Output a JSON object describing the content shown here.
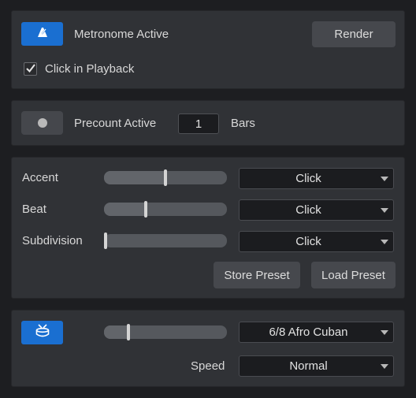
{
  "metronome": {
    "active_label": "Metronome Active",
    "render_label": "Render",
    "click_in_playback_label": "Click in Playback",
    "click_in_playback_checked": true
  },
  "precount": {
    "active_label": "Precount Active",
    "bars_value": "1",
    "bars_label": "Bars"
  },
  "sounds": {
    "rows": [
      {
        "label": "Accent",
        "level": 0.5,
        "sound": "Click"
      },
      {
        "label": "Beat",
        "level": 0.34,
        "sound": "Click"
      },
      {
        "label": "Subdivision",
        "level": 0.0,
        "sound": "Click"
      }
    ],
    "store_preset_label": "Store Preset",
    "load_preset_label": "Load Preset"
  },
  "pattern": {
    "volume_level": 0.2,
    "style": "6/8 Afro Cuban",
    "speed_label": "Speed",
    "speed_value": "Normal"
  },
  "colors": {
    "accent_blue": "#1a6fd1",
    "panel": "#303236",
    "background": "#1d1e21"
  }
}
